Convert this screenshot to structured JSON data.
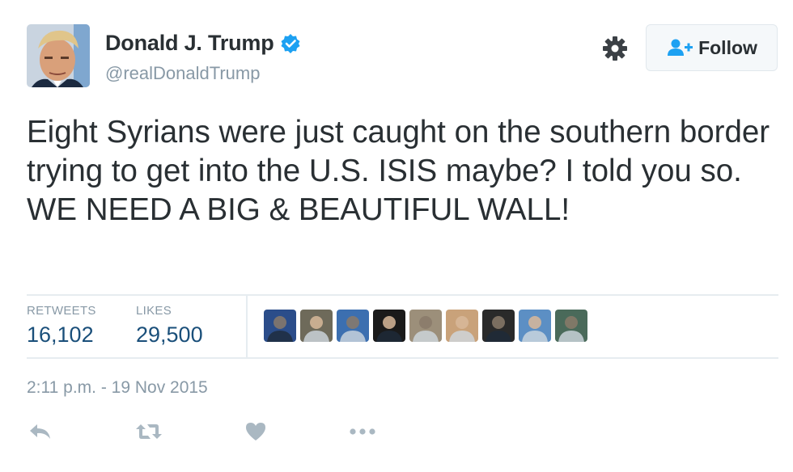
{
  "user": {
    "name": "Donald J. Trump",
    "handle": "@realDonaldTrump",
    "verified": true
  },
  "header": {
    "follow_label": "Follow",
    "gear_icon": "gear-icon",
    "follow_icon": "add-user-icon"
  },
  "tweet": {
    "text": "Eight Syrians were just caught on the southern border trying to get into the U.S. ISIS maybe? I told you so. WE NEED A BIG & BEAUTIFUL WALL!",
    "timestamp": "2:11 p.m. - 19 Nov 2015"
  },
  "stats": {
    "retweets_label": "RETWEETS",
    "retweets_value": "16,102",
    "likes_label": "LIKES",
    "likes_value": "29,500"
  },
  "likers": [
    {
      "icon": "avatar-1",
      "bg": "#2b4d8a"
    },
    {
      "icon": "avatar-2",
      "bg": "#6e6a5a"
    },
    {
      "icon": "avatar-3",
      "bg": "#3c6fb0"
    },
    {
      "icon": "avatar-4",
      "bg": "#1a1a1a"
    },
    {
      "icon": "avatar-5",
      "bg": "#9c8f7a"
    },
    {
      "icon": "avatar-6",
      "bg": "#c9a27a"
    },
    {
      "icon": "avatar-7",
      "bg": "#2a2a2a"
    },
    {
      "icon": "avatar-8",
      "bg": "#5c8fc4"
    },
    {
      "icon": "avatar-9",
      "bg": "#4a6a5a"
    }
  ],
  "actions": {
    "reply_icon": "reply-icon",
    "retweet_icon": "retweet-icon",
    "like_icon": "heart-icon",
    "more_icon": "more-icon"
  },
  "colors": {
    "verified": "#1da1f2",
    "stat_value": "#1a4f7a",
    "muted": "#8899a6",
    "action_icon": "#aab8c2"
  }
}
